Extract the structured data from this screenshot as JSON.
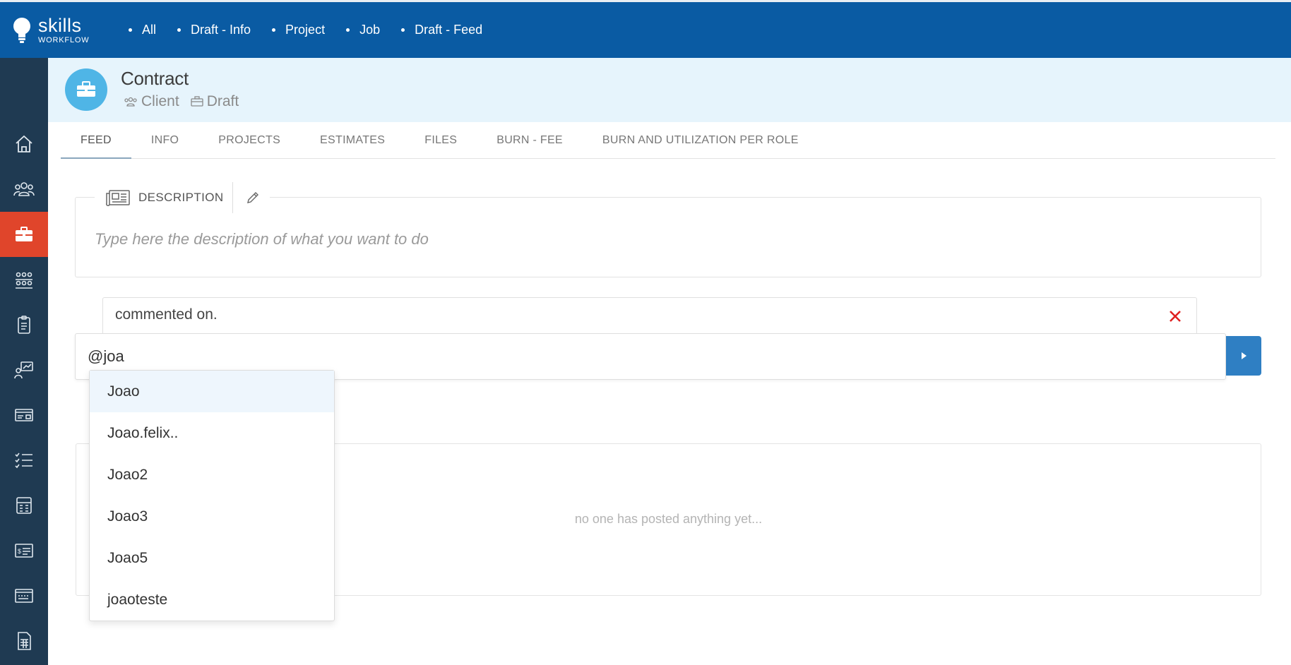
{
  "app": {
    "logo_main": "skills",
    "logo_sub": "WORKFLOW",
    "brand_color": "#0a5ba3",
    "sidebar_color": "#1f3a52",
    "active_color": "#e0452b"
  },
  "topnav": {
    "items": [
      {
        "label": "All"
      },
      {
        "label": "Draft - Info"
      },
      {
        "label": "Project"
      },
      {
        "label": "Job"
      },
      {
        "label": "Draft - Feed"
      }
    ]
  },
  "sidebar": {
    "items": [
      {
        "icon": "home-icon"
      },
      {
        "icon": "users-icon"
      },
      {
        "icon": "briefcase-icon",
        "active": true
      },
      {
        "icon": "team-icon"
      },
      {
        "icon": "clipboard-icon"
      },
      {
        "icon": "presentation-icon"
      },
      {
        "icon": "card-icon"
      },
      {
        "icon": "checklist-icon"
      },
      {
        "icon": "calculator-icon"
      },
      {
        "icon": "invoice-icon"
      },
      {
        "icon": "payment-card-icon"
      },
      {
        "icon": "spreadsheet-icon"
      }
    ]
  },
  "header": {
    "title": "Contract",
    "client_label": "Client",
    "status_label": "Draft"
  },
  "tabs": [
    {
      "label": "FEED",
      "active": true
    },
    {
      "label": "INFO"
    },
    {
      "label": "PROJECTS"
    },
    {
      "label": "ESTIMATES"
    },
    {
      "label": "FILES"
    },
    {
      "label": "BURN - FEE"
    },
    {
      "label": "BURN AND UTILIZATION PER ROLE"
    }
  ],
  "description": {
    "label": "DESCRIPTION",
    "placeholder": "Type here the description of what you want to do"
  },
  "comment": {
    "reference_text": "commented on.",
    "input_value": "@joa"
  },
  "mentions": [
    {
      "name": "Joao",
      "highlighted": true
    },
    {
      "name": "Joao.felix.."
    },
    {
      "name": "Joao2"
    },
    {
      "name": "Joao3"
    },
    {
      "name": "Joao5"
    },
    {
      "name": "joaoteste"
    }
  ],
  "feed": {
    "empty_message": "no one has posted anything yet..."
  }
}
